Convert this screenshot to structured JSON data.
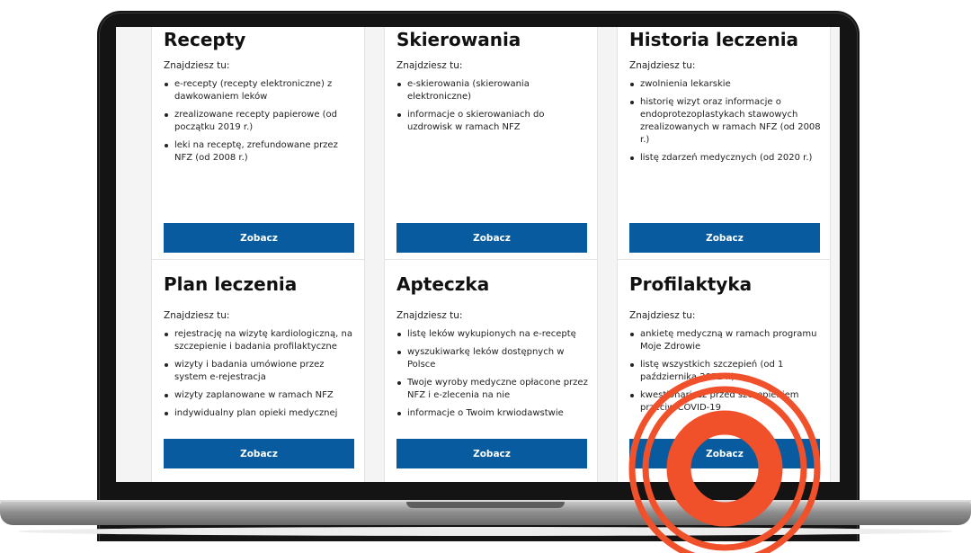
{
  "cards": [
    {
      "title": "Recepty",
      "intro": "Znajdziesz tu:",
      "items": [
        "e-recepty (recepty elektroniczne) z dawkowaniem leków",
        "zrealizowane recepty papierowe (od początku 2019 r.)",
        "leki na receptę, zrefundowane przez NFZ (od 2008 r.)"
      ],
      "button": "Zobacz"
    },
    {
      "title": "Skierowania",
      "intro": "Znajdziesz tu:",
      "items": [
        "e-skierowania (skierowania elektroniczne)",
        "informacje o skierowaniach do uzdrowisk w ramach NFZ"
      ],
      "button": "Zobacz"
    },
    {
      "title": "Historia leczenia",
      "intro": "Znajdziesz tu:",
      "items": [
        "zwolnienia lekarskie",
        "historię wizyt oraz informacje o endoprotezoplastykach stawowych zrealizowanych w ramach NFZ (od 2008 r.)",
        "listę zdarzeń medycznych (od 2020 r.)"
      ],
      "button": "Zobacz"
    },
    {
      "title": "Plan leczenia",
      "intro": "Znajdziesz tu:",
      "items": [
        "rejestrację na wizytę kardiologiczną, na szczepienie i badania profilaktyczne",
        "wizyty i badania umówione przez system e-rejestracja",
        "wizyty zaplanowane w ramach NFZ",
        "indywidualny plan opieki medycznej"
      ],
      "button": "Zobacz"
    },
    {
      "title": "Apteczka",
      "intro": "Znajdziesz tu:",
      "items": [
        "listę leków wykupionych na e-receptę",
        "wyszukiwarkę leków dostępnych w Polsce",
        "Twoje wyroby medyczne opłacone przez NFZ i e-zlecenia na nie",
        "informacje o Twoim krwiodawstwie"
      ],
      "button": "Zobacz"
    },
    {
      "title": "Profilaktyka",
      "intro": "Znajdziesz tu:",
      "items": [
        "ankietę medyczną w ramach programu Moje Zdrowie",
        "listę wszystkich szczepień (od 1 października 2022 r.)",
        "kwestionariusz przed szczepieniem przeciw COVID-19"
      ],
      "button": "Zobacz"
    }
  ],
  "colors": {
    "button": "#085b9e",
    "highlight_rings": "#f0502a"
  },
  "highlight": {
    "target": "Profilaktyka Zobacz button",
    "shape": "concentric-rings"
  }
}
